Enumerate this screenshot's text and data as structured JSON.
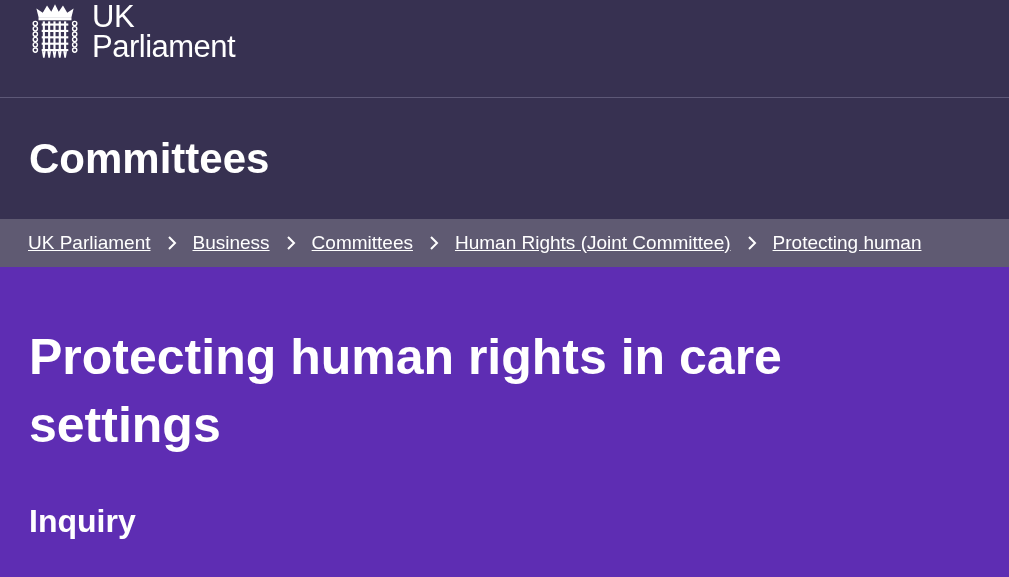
{
  "header": {
    "logo_line_1": "UK",
    "logo_line_2": "Parliament"
  },
  "section_title": "Committees",
  "breadcrumbs": [
    {
      "label": "UK Parliament"
    },
    {
      "label": "Business"
    },
    {
      "label": "Committees"
    },
    {
      "label": "Human Rights (Joint Committee)"
    },
    {
      "label": "Protecting human"
    }
  ],
  "page_title": "Protecting human rights in care settings",
  "page_type": "Inquiry"
}
